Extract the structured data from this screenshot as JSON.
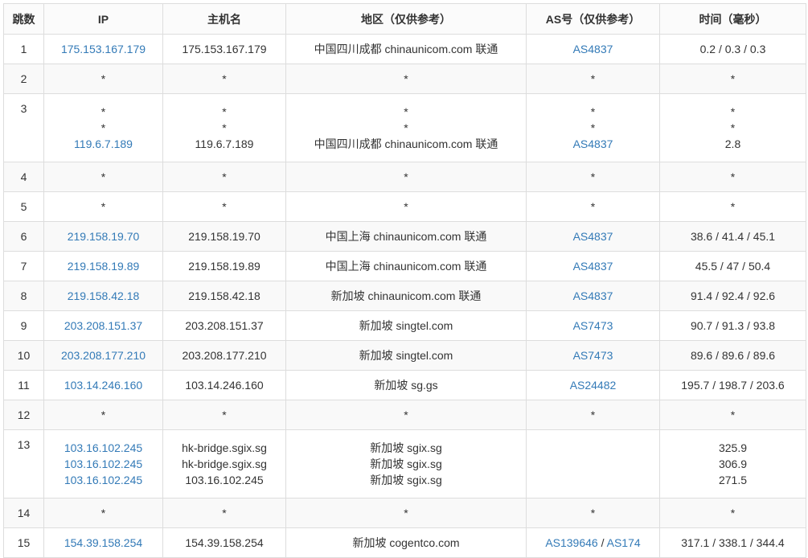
{
  "table": {
    "headers": [
      "跳数",
      "IP",
      "主机名",
      "地区（仅供参考）",
      "AS号（仅供参考）",
      "时间（毫秒）"
    ],
    "rows": [
      {
        "hop": "1",
        "ip": [
          "175.153.167.179"
        ],
        "host": [
          "175.153.167.179"
        ],
        "region": [
          "中国四川成都 chinaunicom.com 联通"
        ],
        "as": [
          [
            "AS4837"
          ]
        ],
        "time": [
          "0.2 / 0.3 / 0.3"
        ]
      },
      {
        "hop": "2",
        "ip": [
          "*"
        ],
        "host": [
          "*"
        ],
        "region": [
          "*"
        ],
        "as": [
          [
            "*"
          ]
        ],
        "time": [
          "*"
        ]
      },
      {
        "hop": "3",
        "ip": [
          "*",
          "*",
          "119.6.7.189"
        ],
        "host": [
          "*",
          "*",
          "119.6.7.189"
        ],
        "region": [
          "*",
          "*",
          "中国四川成都 chinaunicom.com 联通"
        ],
        "as": [
          [
            "*"
          ],
          [
            "*"
          ],
          [
            "AS4837"
          ]
        ],
        "time": [
          "*",
          "*",
          "2.8"
        ]
      },
      {
        "hop": "4",
        "ip": [
          "*"
        ],
        "host": [
          "*"
        ],
        "region": [
          "*"
        ],
        "as": [
          [
            "*"
          ]
        ],
        "time": [
          "*"
        ]
      },
      {
        "hop": "5",
        "ip": [
          "*"
        ],
        "host": [
          "*"
        ],
        "region": [
          "*"
        ],
        "as": [
          [
            "*"
          ]
        ],
        "time": [
          "*"
        ]
      },
      {
        "hop": "6",
        "ip": [
          "219.158.19.70"
        ],
        "host": [
          "219.158.19.70"
        ],
        "region": [
          "中国上海 chinaunicom.com 联通"
        ],
        "as": [
          [
            "AS4837"
          ]
        ],
        "time": [
          "38.6 / 41.4 / 45.1"
        ]
      },
      {
        "hop": "7",
        "ip": [
          "219.158.19.89"
        ],
        "host": [
          "219.158.19.89"
        ],
        "region": [
          "中国上海 chinaunicom.com 联通"
        ],
        "as": [
          [
            "AS4837"
          ]
        ],
        "time": [
          "45.5 / 47 / 50.4"
        ]
      },
      {
        "hop": "8",
        "ip": [
          "219.158.42.18"
        ],
        "host": [
          "219.158.42.18"
        ],
        "region": [
          "新加坡 chinaunicom.com 联通"
        ],
        "as": [
          [
            "AS4837"
          ]
        ],
        "time": [
          "91.4 / 92.4 / 92.6"
        ]
      },
      {
        "hop": "9",
        "ip": [
          "203.208.151.37"
        ],
        "host": [
          "203.208.151.37"
        ],
        "region": [
          "新加坡 singtel.com"
        ],
        "as": [
          [
            "AS7473"
          ]
        ],
        "time": [
          "90.7 / 91.3 / 93.8"
        ]
      },
      {
        "hop": "10",
        "ip": [
          "203.208.177.210"
        ],
        "host": [
          "203.208.177.210"
        ],
        "region": [
          "新加坡 singtel.com"
        ],
        "as": [
          [
            "AS7473"
          ]
        ],
        "time": [
          "89.6 / 89.6 / 89.6"
        ]
      },
      {
        "hop": "11",
        "ip": [
          "103.14.246.160"
        ],
        "host": [
          "103.14.246.160"
        ],
        "region": [
          "新加坡 sg.gs"
        ],
        "as": [
          [
            "AS24482"
          ]
        ],
        "time": [
          "195.7 / 198.7 / 203.6"
        ]
      },
      {
        "hop": "12",
        "ip": [
          "*"
        ],
        "host": [
          "*"
        ],
        "region": [
          "*"
        ],
        "as": [
          [
            "*"
          ]
        ],
        "time": [
          "*"
        ]
      },
      {
        "hop": "13",
        "ip": [
          "103.16.102.245",
          "103.16.102.245",
          "103.16.102.245"
        ],
        "host": [
          "hk-bridge.sgix.sg",
          "hk-bridge.sgix.sg",
          "103.16.102.245"
        ],
        "region": [
          "新加坡 sgix.sg",
          "新加坡 sgix.sg",
          "新加坡 sgix.sg"
        ],
        "as": [],
        "time": [
          "325.9",
          "306.9",
          "271.5"
        ]
      },
      {
        "hop": "14",
        "ip": [
          "*"
        ],
        "host": [
          "*"
        ],
        "region": [
          "*"
        ],
        "as": [
          [
            "*"
          ]
        ],
        "time": [
          "*"
        ]
      },
      {
        "hop": "15",
        "ip": [
          "154.39.158.254"
        ],
        "host": [
          "154.39.158.254"
        ],
        "region": [
          "新加坡 cogentco.com"
        ],
        "as": [
          [
            "AS139646",
            "AS174"
          ]
        ],
        "time": [
          "317.1 / 338.1 / 344.4"
        ]
      }
    ]
  },
  "colors": {
    "link": "#337ab7",
    "text": "#333333",
    "border": "#dddddd",
    "stripe": "#f9f9f9"
  }
}
